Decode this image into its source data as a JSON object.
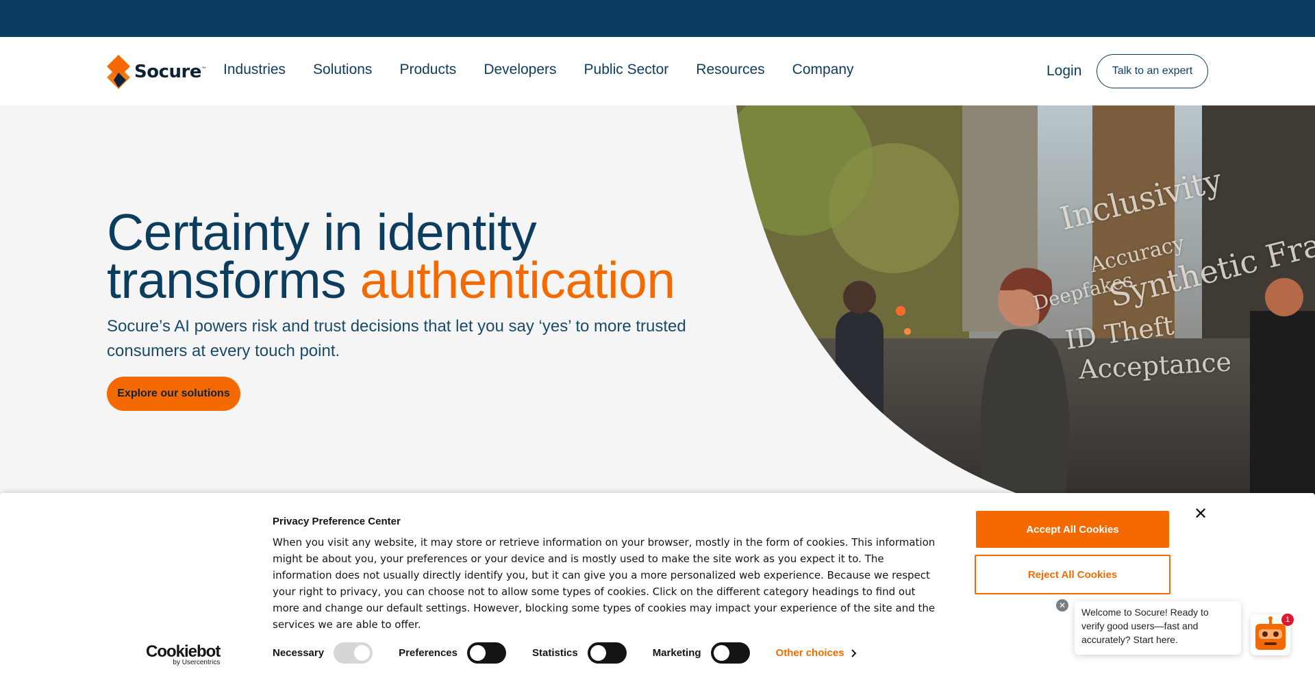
{
  "brand": {
    "name": "Socure",
    "trademark": "™",
    "accent": "#f56a00",
    "navy": "#0c3d5e"
  },
  "nav": {
    "items": [
      "Industries",
      "Solutions",
      "Products",
      "Developers",
      "Public Sector",
      "Resources",
      "Company"
    ],
    "login": "Login",
    "cta": "Talk to an expert"
  },
  "hero": {
    "title_line1": "Certainty in identity",
    "title_line2_plain": "transforms ",
    "title_line2_accent": "authentication",
    "subtitle": "Socure’s AI powers risk and trust decisions that let you say ‘yes’ to more trusted consumers at every touch point.",
    "button": "Explore our solutions",
    "photo_words": [
      "Inclusivity",
      "Accuracy",
      "Deepfakes",
      "Synthetic Frau",
      "ID Theft",
      "Acceptance"
    ]
  },
  "cookie": {
    "title": "Privacy Preference Center",
    "body": "When you visit any website, it may store or retrieve information on your browser, mostly in the form of cookies. This information might be about you, your preferences or your device and is mostly used to make the site work as you expect it to. The information does not usually directly identify you, but it can give you a more personalized web experience. Because we respect your right to privacy, you can choose not to allow some types of cookies. Click on the different category headings to find out more and change our default settings. However, blocking some types of cookies may impact your experience of the site and the services we are able to offer.",
    "accept": "Accept All Cookies",
    "reject": "Reject All Cookies",
    "categories": [
      "Necessary",
      "Preferences",
      "Statistics",
      "Marketing"
    ],
    "other_choices": "Other choices",
    "provider": "Cookiebot",
    "provider_by": "by Usercentrics"
  },
  "chat": {
    "message": "Welcome to Socure! Ready to verify good users—fast and accurately? Start here.",
    "badge": "1"
  }
}
